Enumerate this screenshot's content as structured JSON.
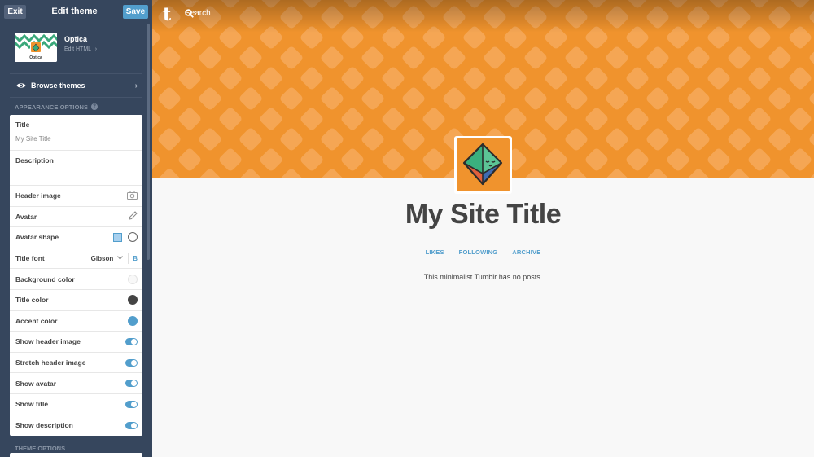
{
  "editor": {
    "exit_label": "Exit",
    "title": "Edit theme",
    "save_label": "Save"
  },
  "theme": {
    "thumb_label": "Optica",
    "name": "Optica",
    "edit_html_label": "Edit HTML",
    "edit_html_chevron": "›"
  },
  "browse": {
    "label": "Browse themes",
    "chevron": "›"
  },
  "appearance": {
    "header": "APPEARANCE OPTIONS",
    "help_glyph": "?",
    "title_label": "Title",
    "title_value": "My Site Title",
    "description_label": "Description",
    "description_value": "",
    "header_image_label": "Header image",
    "avatar_label": "Avatar",
    "avatar_shape_label": "Avatar shape",
    "title_font_label": "Title font",
    "title_font_value": "Gibson",
    "title_font_bold": "B",
    "background_color_label": "Background color",
    "background_color": "#f8f8f8",
    "title_color_label": "Title color",
    "title_color": "#444444",
    "accent_color_label": "Accent color",
    "accent_color": "#529ecc",
    "show_header_image_label": "Show header image",
    "stretch_header_image_label": "Stretch header image",
    "show_avatar_label": "Show avatar",
    "show_title_label": "Show title",
    "show_description_label": "Show description",
    "toggles": {
      "show_header_image": true,
      "stretch_header_image": true,
      "show_avatar": true,
      "show_title": true,
      "show_description": true
    }
  },
  "theme_options": {
    "header": "THEME OPTIONS"
  },
  "preview": {
    "logo": "t",
    "search_label": "Search",
    "site_title": "My Site Title",
    "nav": [
      "LIKES",
      "FOLLOWING",
      "ARCHIVE"
    ],
    "empty_message": "This minimalist Tumblr has no posts.",
    "header_color": "#f0932d"
  },
  "icons": {
    "eye": "eye-icon",
    "camera": "camera-icon",
    "pencil": "pencil-icon",
    "search": "search-icon",
    "chevron_down": "chevron-down-icon"
  }
}
